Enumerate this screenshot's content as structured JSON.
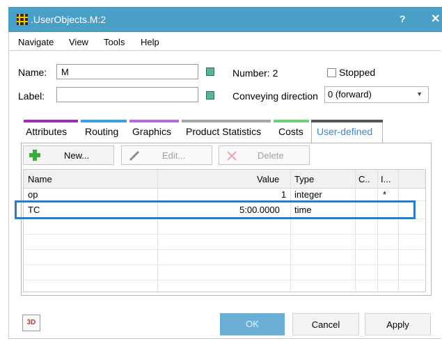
{
  "window": {
    "title": ".UserObjects.M:2",
    "help_glyph": "?",
    "close_glyph": "✕"
  },
  "menu": [
    "Navigate",
    "View",
    "Tools",
    "Help"
  ],
  "fields": {
    "name_label": "Name:",
    "name_value": "M",
    "label_label": "Label:",
    "label_value": "",
    "number_text": "Number: 2",
    "stopped_label": "Stopped",
    "conveying_label": "Conveying direction",
    "conveying_value": "0 (forward)"
  },
  "tabs": [
    {
      "label": "Attributes",
      "color": "#9b2fae"
    },
    {
      "label": "Routing",
      "color": "#3aa0e6"
    },
    {
      "label": "Graphics",
      "color": "#b36bd6"
    },
    {
      "label": "Product Statistics",
      "color": "#a5a5a5"
    },
    {
      "label": "Costs",
      "color": "#6fcf7a"
    },
    {
      "label": "User-defined",
      "color": "#555555"
    }
  ],
  "toolbar": {
    "new_label": "New...",
    "edit_label": "Edit...",
    "delete_label": "Delete"
  },
  "table": {
    "columns": [
      "Name",
      "Value",
      "Type",
      "C..",
      "I..."
    ],
    "rows": [
      {
        "name": "op",
        "value": "1",
        "type": "integer",
        "c": "",
        "i": "*"
      },
      {
        "name": "TC",
        "value": "5:00.0000",
        "type": "time",
        "c": "",
        "i": ""
      }
    ]
  },
  "buttons": {
    "three_d": "3D",
    "ok": "OK",
    "cancel": "Cancel",
    "apply": "Apply"
  },
  "colors": {
    "titlebar": "#4a9fc7",
    "highlight": "#2f7bbf",
    "ok_button": "#6aaed6"
  }
}
